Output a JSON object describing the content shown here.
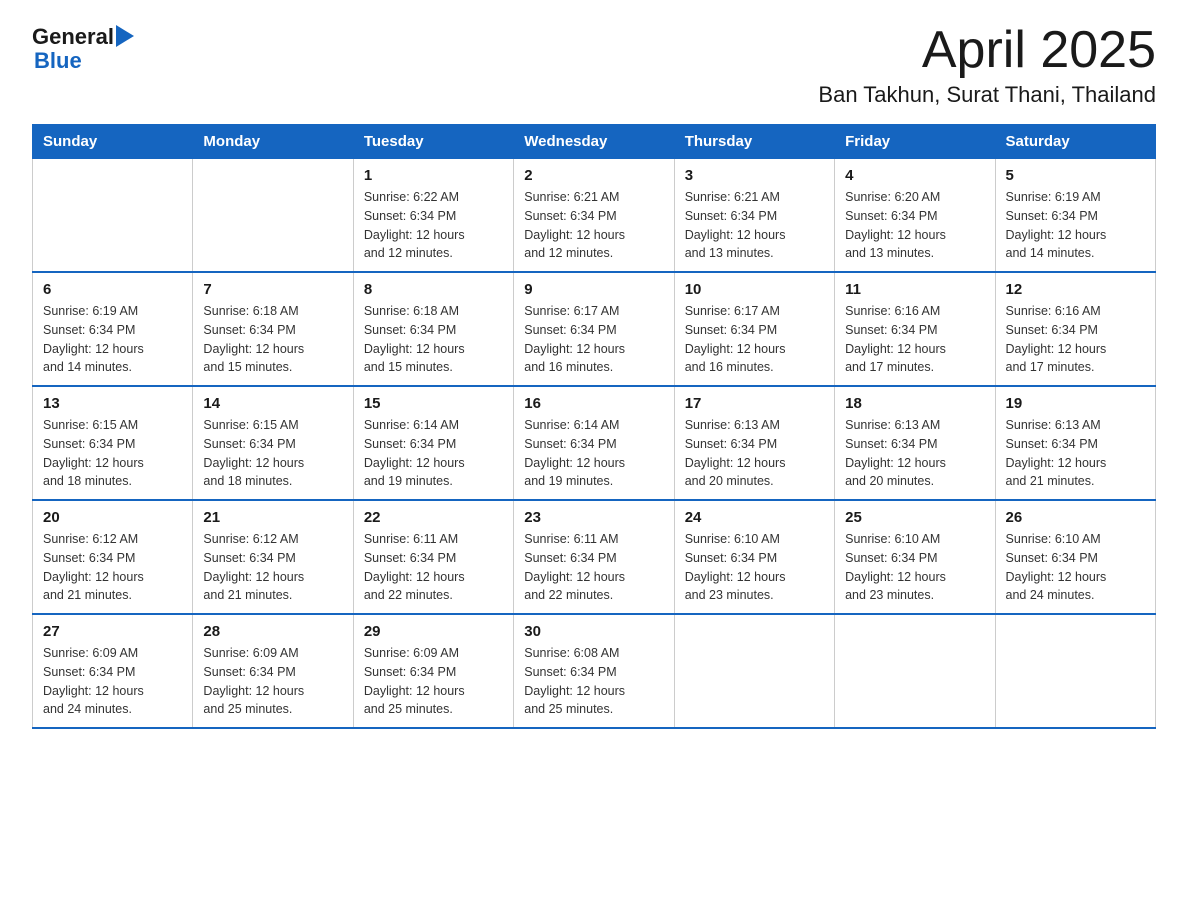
{
  "header": {
    "logo_general": "General",
    "logo_blue": "Blue",
    "month_title": "April 2025",
    "location": "Ban Takhun, Surat Thani, Thailand"
  },
  "calendar": {
    "days_of_week": [
      "Sunday",
      "Monday",
      "Tuesday",
      "Wednesday",
      "Thursday",
      "Friday",
      "Saturday"
    ],
    "weeks": [
      [
        {
          "day": "",
          "info": ""
        },
        {
          "day": "",
          "info": ""
        },
        {
          "day": "1",
          "info": "Sunrise: 6:22 AM\nSunset: 6:34 PM\nDaylight: 12 hours\nand 12 minutes."
        },
        {
          "day": "2",
          "info": "Sunrise: 6:21 AM\nSunset: 6:34 PM\nDaylight: 12 hours\nand 12 minutes."
        },
        {
          "day": "3",
          "info": "Sunrise: 6:21 AM\nSunset: 6:34 PM\nDaylight: 12 hours\nand 13 minutes."
        },
        {
          "day": "4",
          "info": "Sunrise: 6:20 AM\nSunset: 6:34 PM\nDaylight: 12 hours\nand 13 minutes."
        },
        {
          "day": "5",
          "info": "Sunrise: 6:19 AM\nSunset: 6:34 PM\nDaylight: 12 hours\nand 14 minutes."
        }
      ],
      [
        {
          "day": "6",
          "info": "Sunrise: 6:19 AM\nSunset: 6:34 PM\nDaylight: 12 hours\nand 14 minutes."
        },
        {
          "day": "7",
          "info": "Sunrise: 6:18 AM\nSunset: 6:34 PM\nDaylight: 12 hours\nand 15 minutes."
        },
        {
          "day": "8",
          "info": "Sunrise: 6:18 AM\nSunset: 6:34 PM\nDaylight: 12 hours\nand 15 minutes."
        },
        {
          "day": "9",
          "info": "Sunrise: 6:17 AM\nSunset: 6:34 PM\nDaylight: 12 hours\nand 16 minutes."
        },
        {
          "day": "10",
          "info": "Sunrise: 6:17 AM\nSunset: 6:34 PM\nDaylight: 12 hours\nand 16 minutes."
        },
        {
          "day": "11",
          "info": "Sunrise: 6:16 AM\nSunset: 6:34 PM\nDaylight: 12 hours\nand 17 minutes."
        },
        {
          "day": "12",
          "info": "Sunrise: 6:16 AM\nSunset: 6:34 PM\nDaylight: 12 hours\nand 17 minutes."
        }
      ],
      [
        {
          "day": "13",
          "info": "Sunrise: 6:15 AM\nSunset: 6:34 PM\nDaylight: 12 hours\nand 18 minutes."
        },
        {
          "day": "14",
          "info": "Sunrise: 6:15 AM\nSunset: 6:34 PM\nDaylight: 12 hours\nand 18 minutes."
        },
        {
          "day": "15",
          "info": "Sunrise: 6:14 AM\nSunset: 6:34 PM\nDaylight: 12 hours\nand 19 minutes."
        },
        {
          "day": "16",
          "info": "Sunrise: 6:14 AM\nSunset: 6:34 PM\nDaylight: 12 hours\nand 19 minutes."
        },
        {
          "day": "17",
          "info": "Sunrise: 6:13 AM\nSunset: 6:34 PM\nDaylight: 12 hours\nand 20 minutes."
        },
        {
          "day": "18",
          "info": "Sunrise: 6:13 AM\nSunset: 6:34 PM\nDaylight: 12 hours\nand 20 minutes."
        },
        {
          "day": "19",
          "info": "Sunrise: 6:13 AM\nSunset: 6:34 PM\nDaylight: 12 hours\nand 21 minutes."
        }
      ],
      [
        {
          "day": "20",
          "info": "Sunrise: 6:12 AM\nSunset: 6:34 PM\nDaylight: 12 hours\nand 21 minutes."
        },
        {
          "day": "21",
          "info": "Sunrise: 6:12 AM\nSunset: 6:34 PM\nDaylight: 12 hours\nand 21 minutes."
        },
        {
          "day": "22",
          "info": "Sunrise: 6:11 AM\nSunset: 6:34 PM\nDaylight: 12 hours\nand 22 minutes."
        },
        {
          "day": "23",
          "info": "Sunrise: 6:11 AM\nSunset: 6:34 PM\nDaylight: 12 hours\nand 22 minutes."
        },
        {
          "day": "24",
          "info": "Sunrise: 6:10 AM\nSunset: 6:34 PM\nDaylight: 12 hours\nand 23 minutes."
        },
        {
          "day": "25",
          "info": "Sunrise: 6:10 AM\nSunset: 6:34 PM\nDaylight: 12 hours\nand 23 minutes."
        },
        {
          "day": "26",
          "info": "Sunrise: 6:10 AM\nSunset: 6:34 PM\nDaylight: 12 hours\nand 24 minutes."
        }
      ],
      [
        {
          "day": "27",
          "info": "Sunrise: 6:09 AM\nSunset: 6:34 PM\nDaylight: 12 hours\nand 24 minutes."
        },
        {
          "day": "28",
          "info": "Sunrise: 6:09 AM\nSunset: 6:34 PM\nDaylight: 12 hours\nand 25 minutes."
        },
        {
          "day": "29",
          "info": "Sunrise: 6:09 AM\nSunset: 6:34 PM\nDaylight: 12 hours\nand 25 minutes."
        },
        {
          "day": "30",
          "info": "Sunrise: 6:08 AM\nSunset: 6:34 PM\nDaylight: 12 hours\nand 25 minutes."
        },
        {
          "day": "",
          "info": ""
        },
        {
          "day": "",
          "info": ""
        },
        {
          "day": "",
          "info": ""
        }
      ]
    ]
  }
}
